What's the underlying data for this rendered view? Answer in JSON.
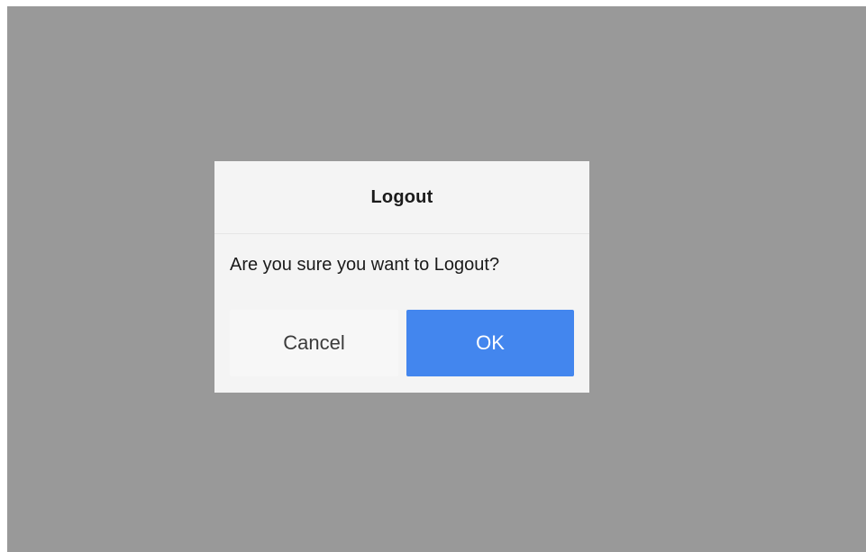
{
  "dialog": {
    "title": "Logout",
    "message": "Are you sure you want to Logout?",
    "cancel_label": "Cancel",
    "ok_label": "OK"
  },
  "colors": {
    "overlay": "#999999",
    "dialog_background": "#f4f4f4",
    "primary_button": "#4386ee",
    "secondary_button": "#f7f7f7"
  }
}
